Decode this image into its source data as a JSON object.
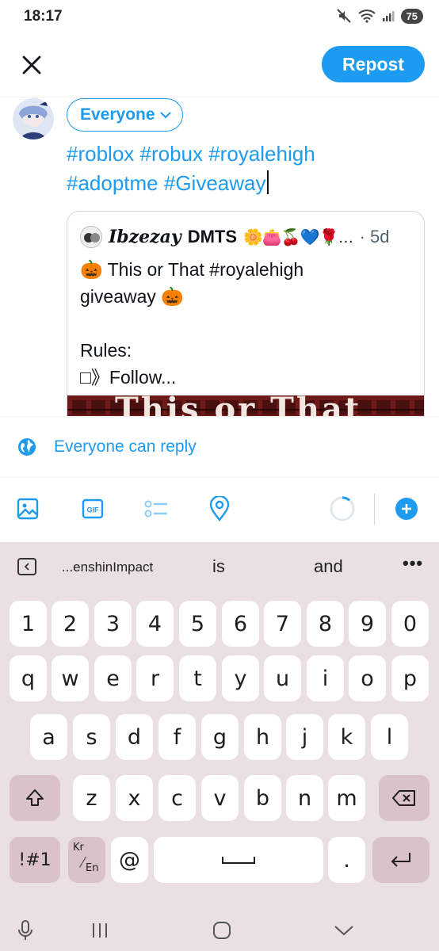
{
  "status_bar": {
    "time": "18:17",
    "battery": "75",
    "icons": [
      "mute-icon",
      "wifi-icon",
      "signal-icon"
    ]
  },
  "header": {
    "close_icon": "close-icon",
    "repost_label": "Repost"
  },
  "composer": {
    "audience_label": "Everyone",
    "text_line1": "#roblox #robux #royalehigh",
    "text_line2": "#adoptme #Giveaway"
  },
  "quote": {
    "name_italic": "Ibzezay",
    "name_rest": "DMTS",
    "emojis": "🌼👛🍒💙🌹…",
    "time": "· 5d",
    "body": "🎃 This or That #royalehigh\ngiveaway 🎃\n\nRules:\n□》Follow...",
    "image_text": "This  or  That"
  },
  "reply_setting": {
    "label": "Everyone can reply"
  },
  "toolbar": {
    "icons": [
      "image-icon",
      "gif-icon",
      "poll-icon",
      "location-icon",
      "char-counter-icon",
      "add-icon"
    ],
    "gif_label": "GIF"
  },
  "keyboard": {
    "suggestions": [
      "...enshinImpact",
      "is",
      "and"
    ],
    "more": "•••",
    "row_numbers": [
      "1",
      "2",
      "3",
      "4",
      "5",
      "6",
      "7",
      "8",
      "9",
      "0"
    ],
    "row1": [
      "q",
      "w",
      "e",
      "r",
      "t",
      "y",
      "u",
      "i",
      "o",
      "p"
    ],
    "row2": [
      "a",
      "s",
      "d",
      "f",
      "g",
      "h",
      "j",
      "k",
      "l"
    ],
    "row3": [
      "z",
      "x",
      "c",
      "v",
      "b",
      "n",
      "m"
    ],
    "symbols_label": "!#1",
    "lang_top": "Kr",
    "lang_bottom": "En",
    "at_label": "@",
    "period_label": "."
  }
}
